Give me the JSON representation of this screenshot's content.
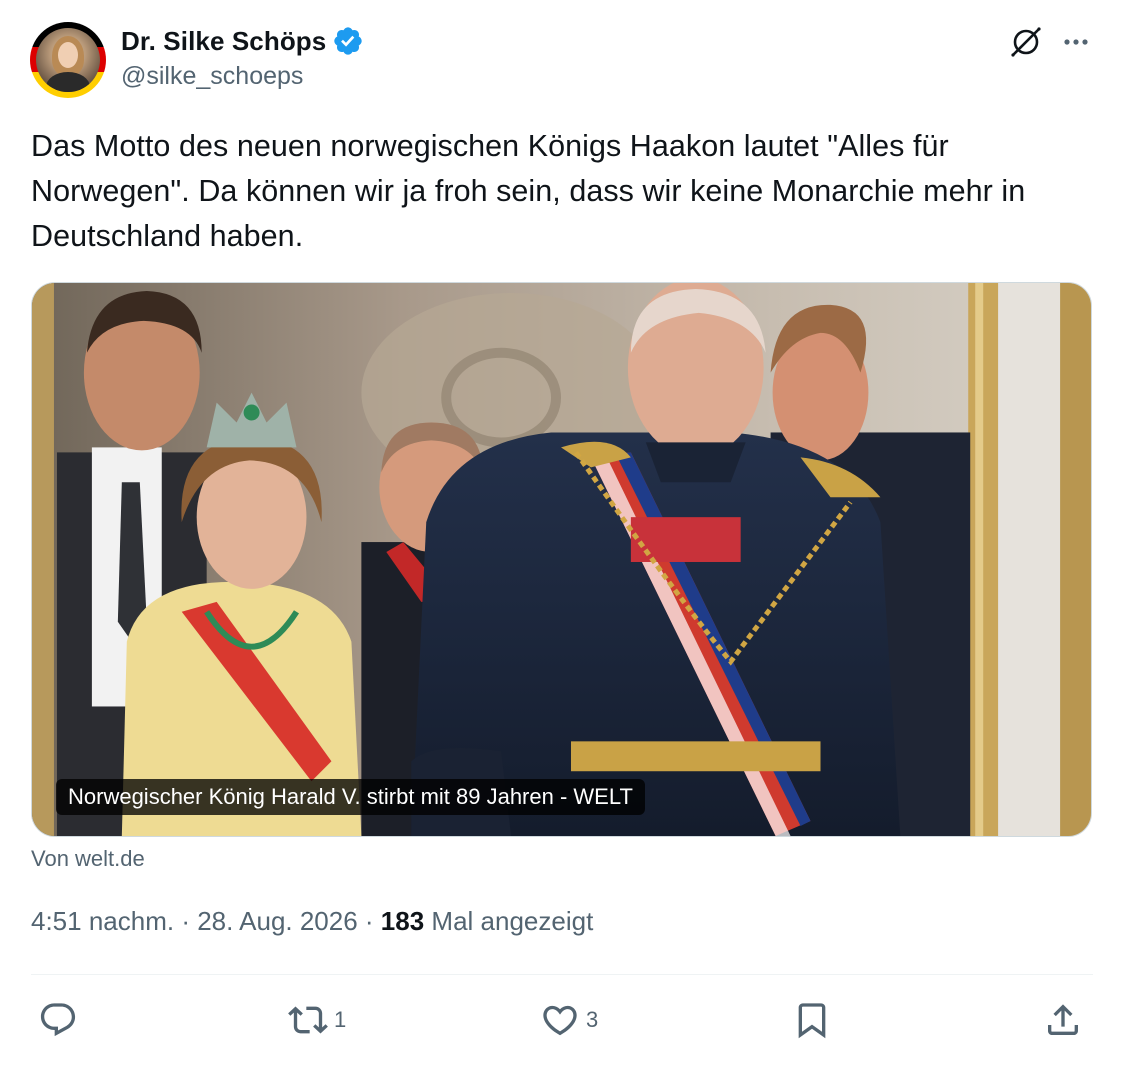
{
  "author": {
    "display_name": "Dr. Silke Schöps",
    "handle": "@silke_schoeps",
    "verified": true
  },
  "tweet": {
    "text": "Das Motto des neuen norwegischen Königs Haakon lautet \"Alles für Norwegen\". Da können wir ja froh sein, dass wir keine Monarchie mehr in Deutschland haben."
  },
  "card": {
    "caption": "Norwegischer König Harald V. stirbt mit 89 Jahren - WELT",
    "source": "Von welt.de"
  },
  "meta": {
    "time": "4:51 nachm.",
    "separator1": " · ",
    "date": "28. Aug. 2026",
    "separator2": " · ",
    "views_count": "183",
    "views_label": " Mal angezeigt"
  },
  "actions": {
    "reply_count": "",
    "retweet_count": "1",
    "like_count": "3"
  },
  "icons": {
    "verified": "verified-badge-icon",
    "grok": "grok-icon",
    "more": "more-icon",
    "reply": "reply-icon",
    "retweet": "retweet-icon",
    "like": "heart-icon",
    "bookmark": "bookmark-icon",
    "share": "share-icon"
  },
  "colors": {
    "text_primary": "#0f1419",
    "text_secondary": "#536471",
    "verified_blue": "#1d9bf0",
    "divider": "#eff3f4"
  }
}
